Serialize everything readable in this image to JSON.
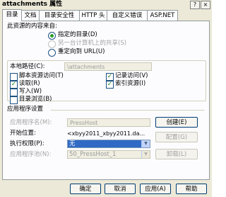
{
  "window": {
    "title": "attachments 属性",
    "help_glyph": "?",
    "close_glyph": "×"
  },
  "tabs": [
    "目录",
    "文档",
    "目录安全性",
    "HTTP 头",
    "自定义错误",
    "ASP.NET"
  ],
  "content_source": {
    "heading": "此资源的内容来自:",
    "options": [
      "指定的目录(D)",
      "另一台计算机上的共享(S)",
      "重定向到 URL(U)"
    ]
  },
  "local_path": {
    "label": "本地路径(C):",
    "value": "\\attachments"
  },
  "checkboxes": {
    "script_source_access": "脚本资源访问(T)",
    "read": "读取(R)",
    "write": "写入(W)",
    "directory_browsing": "目录浏览(B)",
    "log_visits": "记录访问(V)",
    "index_resource": "索引资源(I)"
  },
  "app_settings": {
    "heading": "应用程序设置",
    "app_name_label": "应用程序名(M):",
    "app_name_value": "PressHost",
    "start_point_label": "开始位置:",
    "start_point_value": "<xbyy2011_xbyy2011.da...",
    "exec_perms_label": "执行权限(P):",
    "exec_perms_value": "无",
    "app_pool_label": "应用程序池(N):",
    "app_pool_value": "50_PressHost_1",
    "create_button": "创建(E)",
    "config_button": "配置(G)",
    "unload_button": "卸载(L)"
  },
  "footer": {
    "ok": "确定",
    "cancel": "取消",
    "apply": "应用(A)",
    "help": "帮助"
  }
}
